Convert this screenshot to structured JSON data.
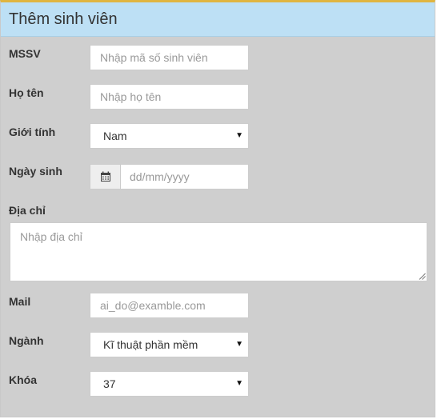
{
  "panel": {
    "title": "Thêm sinh viên"
  },
  "form": {
    "mssv": {
      "label": "MSSV",
      "placeholder": "Nhập mã số sinh viên"
    },
    "ho_ten": {
      "label": "Họ tên",
      "placeholder": "Nhập họ tên"
    },
    "gioi_tinh": {
      "label": "Giới tính",
      "selected": "Nam"
    },
    "ngay_sinh": {
      "label": "Ngày sinh",
      "placeholder": "dd/mm/yyyy",
      "icon": "calendar-icon"
    },
    "dia_chi": {
      "label": "Địa chỉ",
      "placeholder": "Nhập địa chỉ"
    },
    "mail": {
      "label": "Mail",
      "placeholder": "ai_do@examble.com"
    },
    "nganh": {
      "label": "Ngành",
      "selected": "Kĩ thuật phần mềm"
    },
    "khoa": {
      "label": "Khóa",
      "selected": "37"
    }
  },
  "colors": {
    "header_bg": "#bde0f5",
    "panel_bg": "#cfcfcf",
    "top_border": "#e0b540"
  }
}
